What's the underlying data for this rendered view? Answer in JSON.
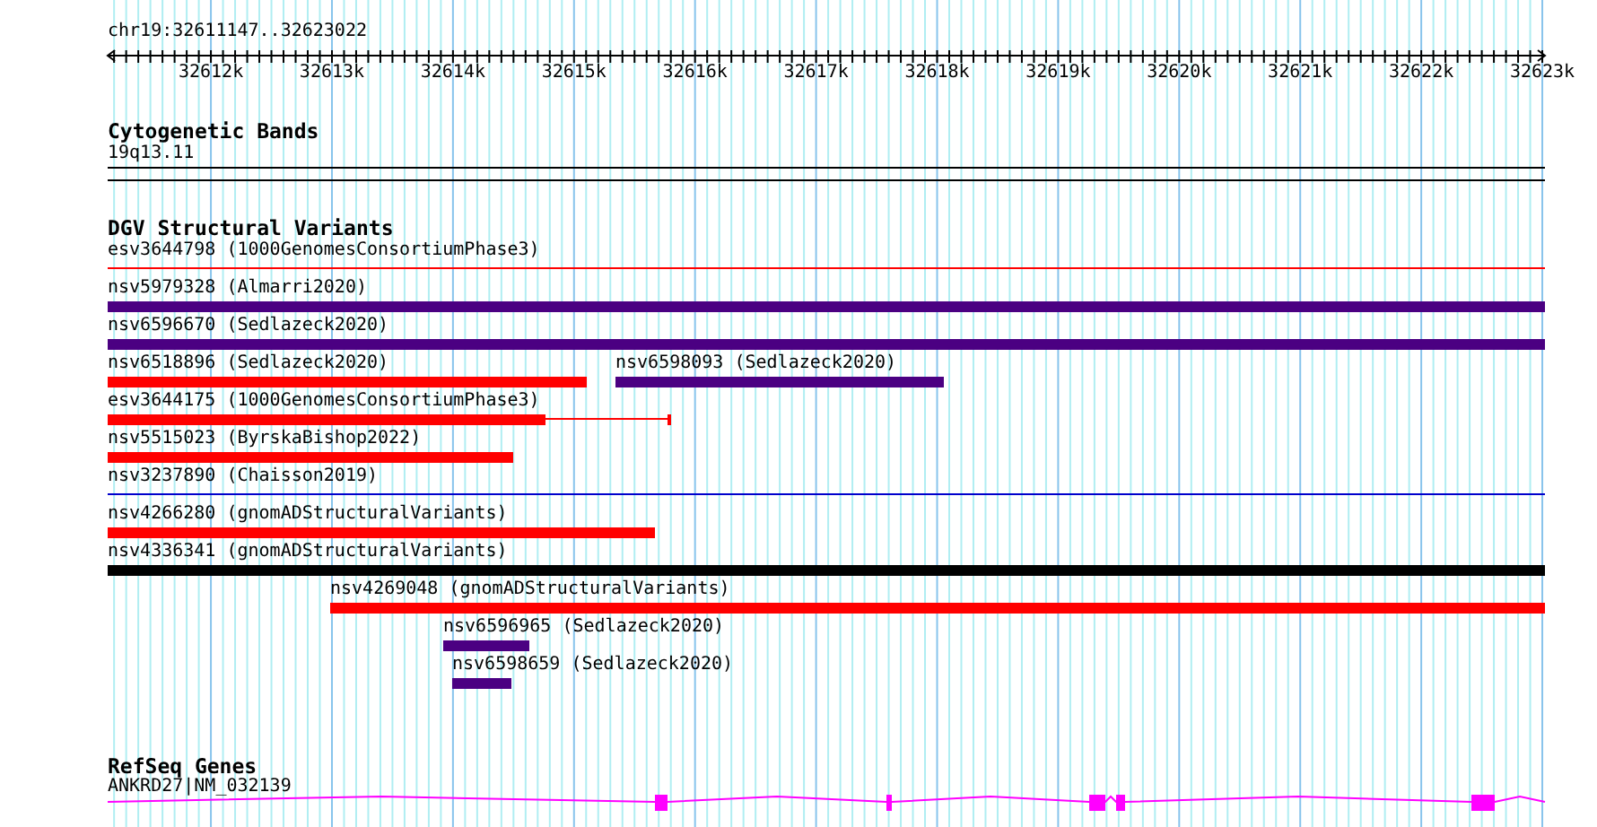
{
  "location": "chr19:32611147..32623022",
  "ruler": {
    "tick_labels": [
      "32612k",
      "32613k",
      "32614k",
      "32615k",
      "32616k",
      "32617k",
      "32618k",
      "32619k",
      "32620k",
      "32621k",
      "32622k",
      "32623k"
    ]
  },
  "tracks": [
    {
      "kind": "cytoband",
      "title": "Cytogenetic Bands",
      "features": [
        {
          "label": "19q13.11"
        }
      ]
    },
    {
      "kind": "variants",
      "title": "DGV Structural Variants",
      "features": [
        {
          "label": "esv3644798 (1000GenomesConsortiumPhase3)",
          "kind": "line",
          "color": "#ff0000"
        },
        {
          "label": "nsv5979328 (Almarri2020)",
          "kind": "bar",
          "color": "#4b0082"
        },
        {
          "label": "nsv6596670 (Sedlazeck2020)",
          "kind": "bar",
          "color": "#4b0082"
        },
        {
          "label": "nsv6518896 (Sedlazeck2020)",
          "kind": "bar",
          "color": "#ff0000"
        },
        {
          "label": "nsv6598093 (Sedlazeck2020)",
          "kind": "bar",
          "color": "#4b0082"
        },
        {
          "label": "esv3644175 (1000GenomesConsortiumPhase3)",
          "kind": "bar",
          "color": "#ff0000"
        },
        {
          "label": "nsv5515023 (ByrskaBishop2022)",
          "kind": "bar",
          "color": "#ff0000"
        },
        {
          "label": "nsv3237890 (Chaisson2019)",
          "kind": "line",
          "color": "#0000cc"
        },
        {
          "label": "nsv4266280 (gnomADStructuralVariants)",
          "kind": "bar",
          "color": "#ff0000"
        },
        {
          "label": "nsv4336341 (gnomADStructuralVariants)",
          "kind": "bar",
          "color": "#000000"
        },
        {
          "label": "nsv4269048 (gnomADStructuralVariants)",
          "kind": "bar",
          "color": "#ff0000"
        },
        {
          "label": "nsv6596965 (Sedlazeck2020)",
          "kind": "bar",
          "color": "#4b0082"
        },
        {
          "label": "nsv6598659 (Sedlazeck2020)",
          "kind": "bar",
          "color": "#4b0082"
        }
      ]
    },
    {
      "kind": "genes",
      "title": "RefSeq Genes",
      "features": [
        {
          "label": "ANKRD27|NM_032139"
        }
      ]
    }
  ]
}
